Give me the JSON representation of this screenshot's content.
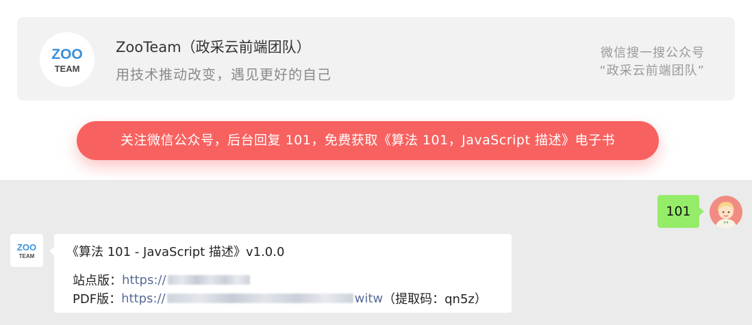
{
  "card": {
    "logo_top": "ZOO",
    "logo_bottom": "TEAM",
    "title": "ZooTeam（政采云前端团队）",
    "slogan": "用技术推动改变，遇见更好的自己",
    "search_line1": "微信搜一搜公众号",
    "search_line2": "“政采云前端团队”"
  },
  "banner": {
    "text": "关注微信公众号，后台回复 101，免费获取《算法 101，JavaScript 描述》电子书"
  },
  "chat": {
    "sent_message": "101",
    "bot_logo_top": "ZOO",
    "bot_logo_bottom": "TEAM",
    "received": {
      "title": "《算法 101 - JavaScript 描述》v1.0.0",
      "site_label": "站点版：",
      "site_link_prefix": "https://",
      "pdf_label": "PDF版：",
      "pdf_link_prefix": "https://",
      "pdf_link_suffix": "witw",
      "code_text": "（提取码：qn5z）"
    }
  },
  "colors": {
    "banner": "#f76260",
    "sent_bubble": "#95ec69",
    "link": "#576b95",
    "logo_blue": "#3a8fd8",
    "logo_dark": "#444444"
  }
}
